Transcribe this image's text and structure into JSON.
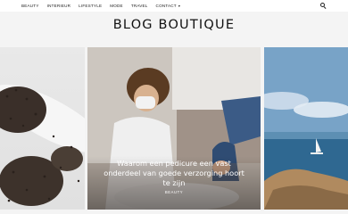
{
  "nav": {
    "items": [
      {
        "label": "BEAUTY"
      },
      {
        "label": "INTERIEUR"
      },
      {
        "label": "LIFESTYLE"
      },
      {
        "label": "MODE"
      },
      {
        "label": "TRAVEL"
      },
      {
        "label": "CONTACT"
      }
    ],
    "contact_caret": "▾"
  },
  "header": {
    "logo": "BLOG BOUTIQUE"
  },
  "slider": {
    "featured": {
      "title": "Waarom een pedicure een vast onderdeel van goede verzorging hoort te zijn",
      "category": "BEAUTY"
    }
  },
  "icons": {
    "search": "search-icon"
  }
}
